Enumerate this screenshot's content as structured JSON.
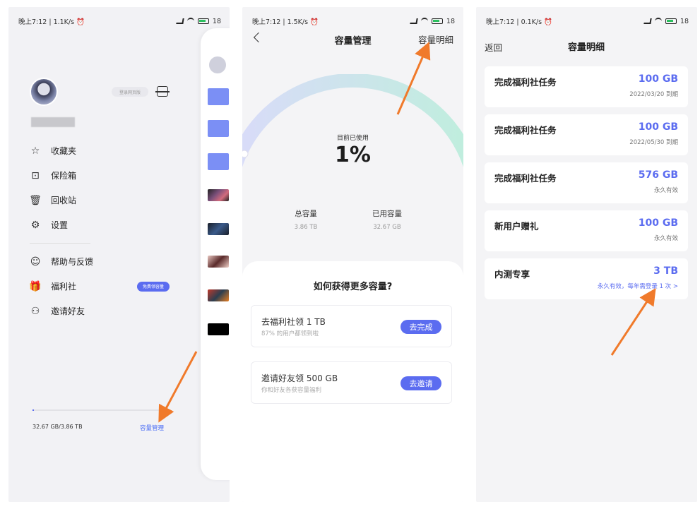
{
  "status_bar": {
    "s1_time": "晚上7:12 | 1.1K/s ⏰",
    "s2_time": "晚上7:12 | 1.5K/s ⏰",
    "s3_time": "晚上7:12 | 0.1K/s ⏰",
    "battery": "18"
  },
  "screen1": {
    "login_label": "登录网页版",
    "menu": [
      {
        "icon": "☆",
        "label": "收藏夹"
      },
      {
        "icon": "⊡",
        "label": "保险箱"
      },
      {
        "icon": "🗑",
        "label": "回收站"
      },
      {
        "icon": "⚙",
        "label": "设置"
      },
      {
        "icon": "☺",
        "label": "帮助与反馈"
      },
      {
        "icon": "🎁",
        "label": "福利社",
        "tag": "免费领容量"
      },
      {
        "icon": "⚇",
        "label": "邀请好友"
      }
    ],
    "usage_fraction": 0.0085,
    "usage_text": "32.67 GB/3.86 TB",
    "capacity_link": "容量管理"
  },
  "screen2": {
    "title": "容量管理",
    "detail_link": "容量明细",
    "used_label": "目前已使用",
    "used_percent": "1%",
    "used_fraction": 0.01,
    "total_label": "总容量",
    "total_value": "3.86 TB",
    "used_cap_label": "已用容量",
    "used_cap_value": "32.67 GB",
    "sheet_title": "如何获得更多容量?",
    "tasks": [
      {
        "title": "去福利社领 1 TB",
        "subtitle": "87% 的用户都领到啦",
        "button": "去完成"
      },
      {
        "title": "邀请好友领 500 GB",
        "subtitle": "你和好友各获容量福利",
        "button": "去邀请"
      }
    ]
  },
  "screen3": {
    "back": "返回",
    "title": "容量明细",
    "items": [
      {
        "label": "完成福利社任务",
        "amount": "100 GB",
        "expiry": "2022/03/20 到期"
      },
      {
        "label": "完成福利社任务",
        "amount": "100 GB",
        "expiry": "2022/05/30 到期"
      },
      {
        "label": "完成福利社任务",
        "amount": "576 GB",
        "expiry": "永久有效"
      },
      {
        "label": "新用户赠礼",
        "amount": "100 GB",
        "expiry": "永久有效"
      },
      {
        "label": "内测专享",
        "amount": "3 TB",
        "expiry": "永久有效，每年需登录 1 次 >"
      }
    ]
  },
  "colors": {
    "accent": "#5b6cf0",
    "arrow": "#f07a2b",
    "gauge_start": "#d9dbf9",
    "gauge_end": "#bfeedd"
  }
}
